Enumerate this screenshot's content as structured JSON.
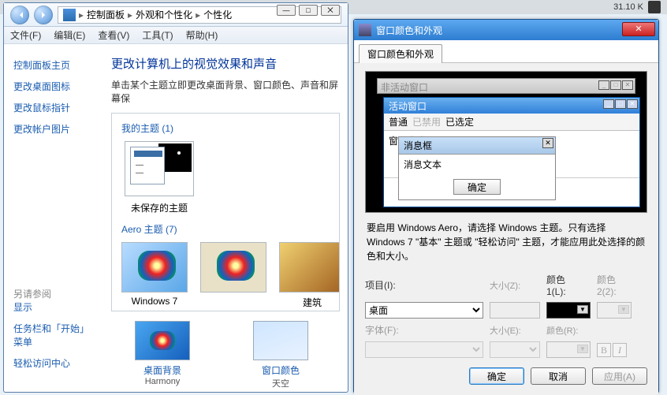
{
  "status": {
    "size": "31.10 K"
  },
  "cp": {
    "win": {
      "min": "—",
      "max": "□",
      "close": "⨉"
    },
    "breadcrumb": {
      "a": "控制面板",
      "b": "外观和个性化",
      "c": "个性化",
      "sep": "▸"
    },
    "menu": {
      "file": "文件(F)",
      "edit": "编辑(E)",
      "view": "查看(V)",
      "tools": "工具(T)",
      "help": "帮助(H)"
    },
    "side": {
      "home": "控制面板主页",
      "l1": "更改桌面图标",
      "l2": "更改鼠标指针",
      "l3": "更改帐户图片",
      "also": "另请参阅",
      "a1": "显示",
      "a2": "任务栏和「开始」菜单",
      "a3": "轻松访问中心"
    },
    "main": {
      "title": "更改计算机上的视觉效果和声音",
      "desc": "单击某个主题立即更改桌面背景、窗口颜色、声音和屏幕保",
      "myThemes": "我的主题 (1)",
      "unsaved": "未保存的主题",
      "aero": "Aero 主题 (7)",
      "a1": "Windows 7",
      "a2": "建筑",
      "link1": "桌面背景",
      "link1s": "Harmony",
      "link2": "窗口颜色",
      "link2s": "天空"
    }
  },
  "ca": {
    "title": "窗口颜色和外观",
    "tab": "窗口颜色和外观",
    "pv": {
      "inactive": "非活动窗口",
      "active": "活动窗口",
      "m1": "普通",
      "m2": "已禁用",
      "m3": "已选定",
      "wtext": "窗口文本",
      "msgbox": "消息框",
      "msgtext": "消息文本",
      "ok": "确定"
    },
    "hint": "要启用 Windows Aero，请选择 Windows 主题。只有选择 Windows 7 \"基本\" 主题或 \"轻松访问\" 主题，才能应用此处选择的颜色和大小。",
    "form": {
      "item": "项目(I):",
      "itemVal": "桌面",
      "size": "大小(Z):",
      "color1h": "颜色",
      "color1": "1(L):",
      "color2h": "颜色",
      "color2": "2(2):",
      "font": "字体(F):",
      "fsize": "大小(E):",
      "fcolor": "颜色(R):"
    },
    "btn": {
      "ok": "确定",
      "cancel": "取消",
      "apply": "应用(A)"
    }
  }
}
